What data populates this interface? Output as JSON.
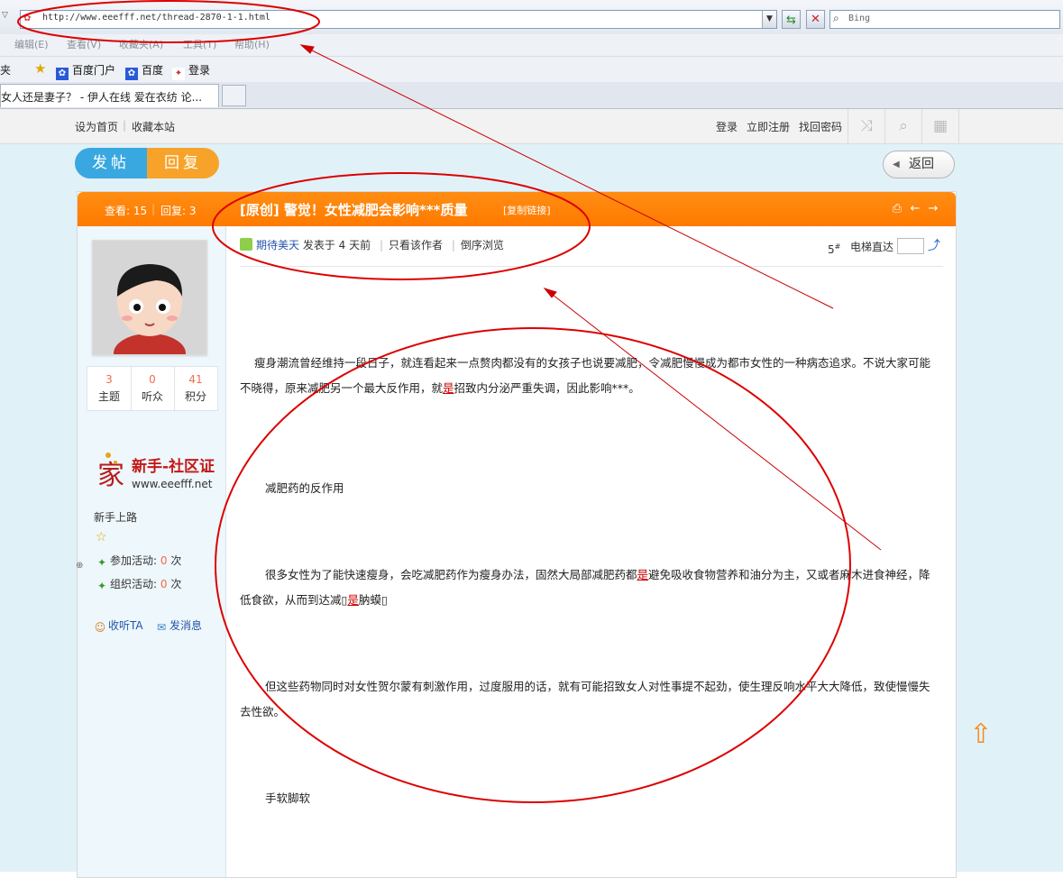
{
  "browser": {
    "url": "http://www.eeefff.net/thread-2870-1-1.html",
    "search_placeholder": "Bing",
    "menu": [
      "编辑(E)",
      "查看(V)",
      "收藏夹(A)",
      "工具(T)",
      "帮助(H)"
    ],
    "favorites_clipped": "夹",
    "favorites": [
      "百度门户",
      "百度",
      "登录"
    ],
    "tab_title": "女人还是妻子？ - 伊人在线 爱在衣纺 论..."
  },
  "site_top": {
    "left_links": [
      "设为首页",
      "收藏本站"
    ],
    "right_links": [
      "登录",
      "立即注册",
      "找回密码"
    ]
  },
  "actions": {
    "post": "发帖",
    "reply": "回复",
    "back": "返回"
  },
  "post_header": {
    "views": "查看: 15",
    "replies": "回复: 3",
    "title": "[原创] 警觉！女性减肥会影响***质量",
    "copy_link": "[复制链接]"
  },
  "author_panel": {
    "stats": [
      {
        "num": "3",
        "label": "主题"
      },
      {
        "num": "0",
        "label": "听众"
      },
      {
        "num": "41",
        "label": "积分"
      }
    ],
    "badge_text": "新手-社区证",
    "badge_url": "www.eeefff.net",
    "rank": "新手上路",
    "activity_join_label": "参加活动:",
    "activity_join_count": "0",
    "activity_org_label": "组织活动:",
    "activity_org_count": "0",
    "unit": "次",
    "follow": "收听TA",
    "message": "发消息"
  },
  "post_meta": {
    "author": "期待美天",
    "posted": "发表于 4 天前",
    "only_author": "只看该作者",
    "reverse": "倒序浏览",
    "floor": "5",
    "floor_suffix": "#",
    "jump_label": "电梯直达"
  },
  "content": {
    "p1_a": "瘦身潮流曾经维持一段日子，就连看起来一点赘肉都没有的女孩子也说要减肥，令减肥慢慢成为都市女性的一种病态追求。不说大家可能不晓得，原来减肥另一个最大反作用，就",
    "p1_red": "是",
    "p1_b": "招致内分泌严重失调，因此影响***。",
    "p2": "减肥药的反作用",
    "p3_a": "很多女性为了能快速瘦身，会吃减肥药作为瘦身办法，固然大局部减肥药都",
    "p3_red": "是",
    "p3_b": "避免吸收食物营养和油分为主，又或者麻木进食神经，降低食欲，从而到达减",
    "p3_red2": "是",
    "p3_c": "肭蟆",
    "p4": "但这些药物同时对女性贺尔蒙有刺激作用，过度服用的话，就有可能招致女人对性事提不起劲，使生理反响水平大大降低，致使慢慢失去性欲。",
    "p5": "手软脚软"
  },
  "colors": {
    "accent_orange": "#ff8000",
    "accent_blue": "#39a8e0",
    "annotation_red": "#dd0000"
  }
}
